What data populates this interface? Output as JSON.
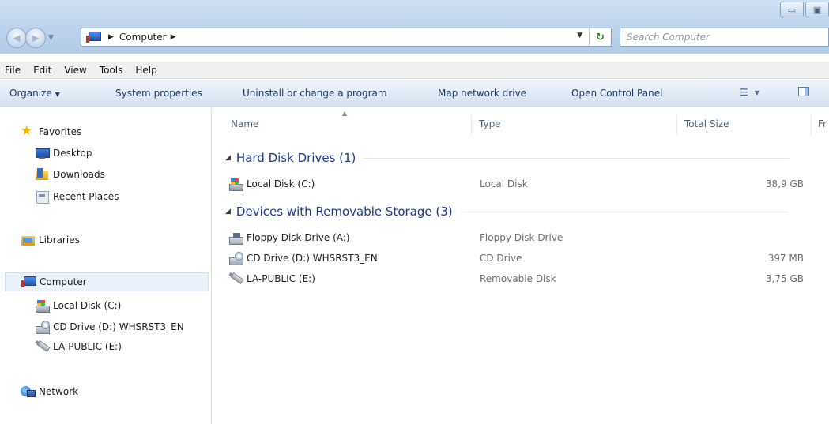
{
  "window": {
    "minimize_glyph": "▭",
    "restore_glyph": "▣"
  },
  "address": {
    "crumbs": [
      "Computer"
    ],
    "search_placeholder": "Search Computer"
  },
  "menu": [
    "File",
    "Edit",
    "View",
    "Tools",
    "Help"
  ],
  "toolbar": {
    "organize": "Organize",
    "system_properties": "System properties",
    "uninstall": "Uninstall or change a program",
    "map_drive": "Map network drive",
    "control_panel": "Open Control Panel"
  },
  "sidebar": {
    "favorites": "Favorites",
    "desktop": "Desktop",
    "downloads": "Downloads",
    "recent_places": "Recent Places",
    "libraries": "Libraries",
    "computer": "Computer",
    "local_disk": "Local Disk (C:)",
    "cd_drive": "CD Drive (D:) WHSRST3_EN",
    "usb": "LA-PUBLIC (E:)",
    "network": "Network"
  },
  "columns": {
    "name": "Name",
    "type": "Type",
    "total_size": "Total Size",
    "free_partial": "Fr"
  },
  "groups": [
    {
      "label": "Hard Disk Drives (1)",
      "items": [
        {
          "name": "Local Disk (C:)",
          "type": "Local Disk",
          "size": "38,9 GB",
          "icon": "local-disk-icon"
        }
      ]
    },
    {
      "label": "Devices with Removable Storage (3)",
      "items": [
        {
          "name": "Floppy Disk Drive (A:)",
          "type": "Floppy Disk Drive",
          "size": "",
          "icon": "floppy-drive-icon"
        },
        {
          "name": "CD Drive (D:) WHSRST3_EN",
          "type": "CD Drive",
          "size": "397 MB",
          "icon": "cd-drive-icon"
        },
        {
          "name": "LA-PUBLIC (E:)",
          "type": "Removable Disk",
          "size": "3,75 GB",
          "icon": "usb-drive-icon"
        }
      ]
    }
  ],
  "colors": {
    "group_header": "#1e3a8a",
    "toolbar_text": "#1e3b63",
    "secondary_text": "#6d6d6d"
  }
}
